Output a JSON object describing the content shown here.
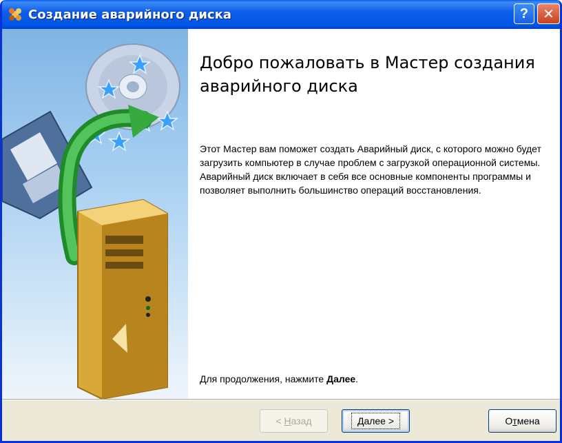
{
  "window": {
    "title": "Создание аварийного диска",
    "help_label": "?",
    "close_label": "✕"
  },
  "content": {
    "heading": "Добро пожаловать в Мастер создания аварийного диска",
    "description": "Этот Мастер вам поможет создать Аварийный диск, с которого можно будет загрузить компьютер в случае проблем с загрузкой операционной системы. Аварийный диск включает в себя все основные компоненты программы и позволяет выполнить большинство операций восстановления.",
    "hint_prefix": "Для продолжения, нажмите ",
    "hint_bold": "Далее",
    "hint_suffix": "."
  },
  "buttons": {
    "back_prefix": "< ",
    "back_hotkey": "Н",
    "back_rest": "азад",
    "next_hotkey": "Д",
    "next_rest": "алее >",
    "cancel_prefix": "О",
    "cancel_hotkey": "т",
    "cancel_rest": "мена"
  },
  "icons": {
    "app": "wizard-app-icon",
    "banner": "floppy-cd-computer-illustration"
  },
  "colors": {
    "titlebar": "#0055e5",
    "close_button": "#c8401e",
    "dialog_face": "#ece9d8"
  }
}
